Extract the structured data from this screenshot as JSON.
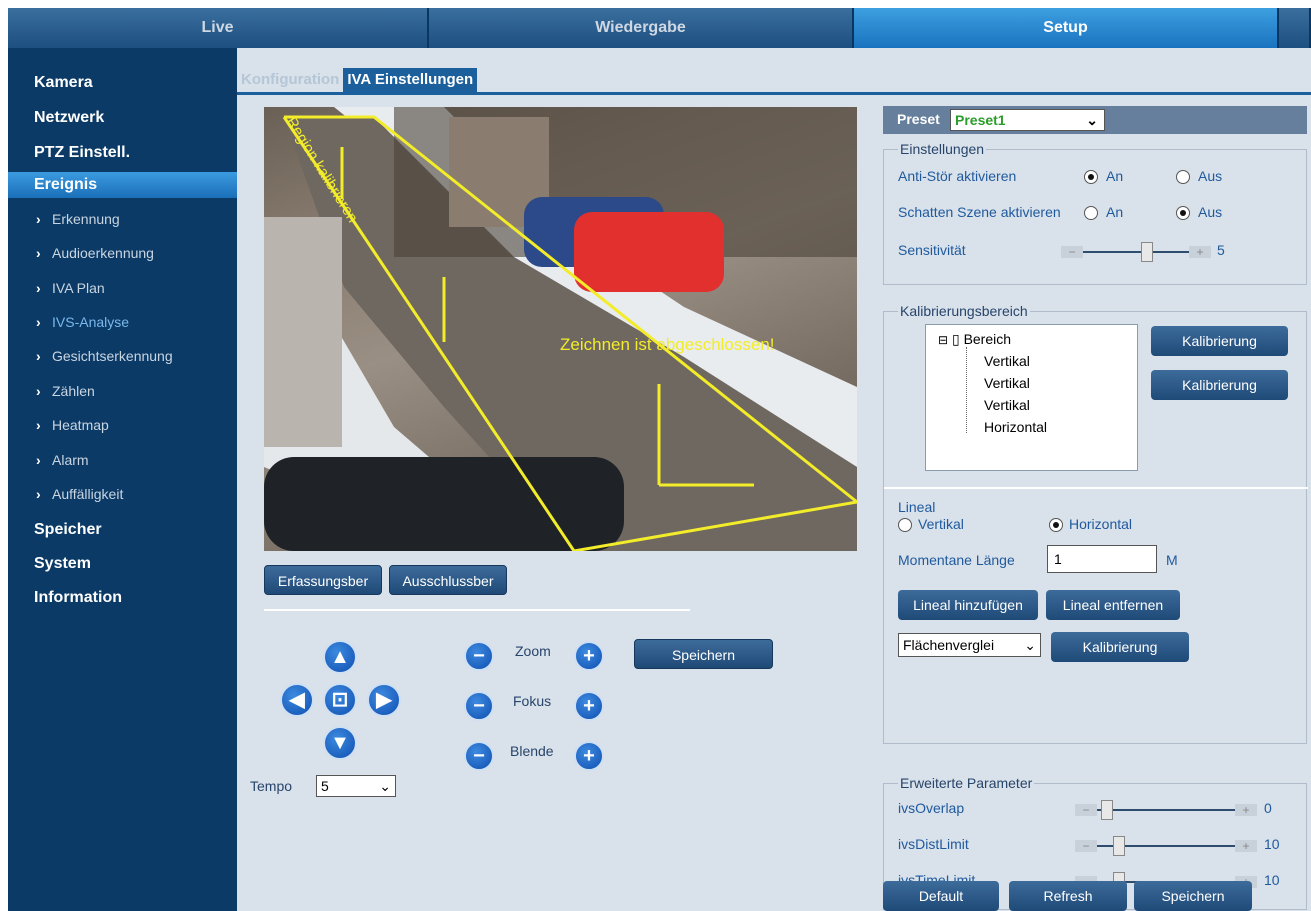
{
  "topnav": {
    "tabs": [
      {
        "label": "Live"
      },
      {
        "label": "Wiedergabe"
      },
      {
        "label": "Setup"
      }
    ]
  },
  "sidebar": {
    "main_items": [
      "Kamera",
      "Netzwerk",
      "PTZ Einstell.",
      "Ereignis",
      "Speicher",
      "System",
      "Information"
    ],
    "sub_items": [
      "Erkennung",
      "Audioerkennung",
      "IVA Plan",
      "IVS-Analyse",
      "Gesichtserkennung",
      "Zählen",
      "Heatmap",
      "Alarm",
      "Auffälligkeit"
    ]
  },
  "subtabs": [
    "Konfiguration",
    "IVA Einstellungen"
  ],
  "video": {
    "region_label": "Region kalibrieren",
    "overlay_text": "Zeichnen ist abgeschlossen!"
  },
  "area_buttons": {
    "detection": "Erfassungsber",
    "exclusion": "Ausschlussber"
  },
  "ptz": {
    "zoom": "Zoom",
    "focus": "Fokus",
    "iris": "Blende",
    "save": "Speichern",
    "tempo_label": "Tempo",
    "tempo_value": "5"
  },
  "preset": {
    "label": "Preset",
    "value": "Preset1"
  },
  "settings": {
    "legend": "Einstellungen",
    "anti_label": "Anti-Stör aktivieren",
    "shadow_label": "Schatten Szene aktivieren",
    "on": "An",
    "off": "Aus",
    "sensitivity_label": "Sensitivität",
    "sensitivity_value": "5"
  },
  "calibration": {
    "legend": "Kalibrierungsbereich",
    "tree_root": "Bereich",
    "tree_items": [
      "Vertikal",
      "Vertikal",
      "Vertikal",
      "Horizontal"
    ],
    "btn1": "Kalibrierung",
    "btn2": "Kalibrierung"
  },
  "ruler": {
    "legend": "Lineal",
    "vertical": "Vertikal",
    "horizontal": "Horizontal",
    "length_label": "Momentane Länge",
    "length_value": "1",
    "unit": "M",
    "add": "Lineal hinzufügen",
    "remove": "Lineal entfernen",
    "compare_value": "Flächenverglei",
    "calib": "Kalibrierung"
  },
  "advanced": {
    "legend": "Erweiterte Parameter",
    "params": [
      {
        "name": "ivsOverlap",
        "value": "0"
      },
      {
        "name": "ivsDistLimit",
        "value": "10"
      },
      {
        "name": "ivsTimeLimit",
        "value": "10"
      }
    ]
  },
  "footer": {
    "default": "Default",
    "refresh": "Refresh",
    "save": "Speichern"
  }
}
